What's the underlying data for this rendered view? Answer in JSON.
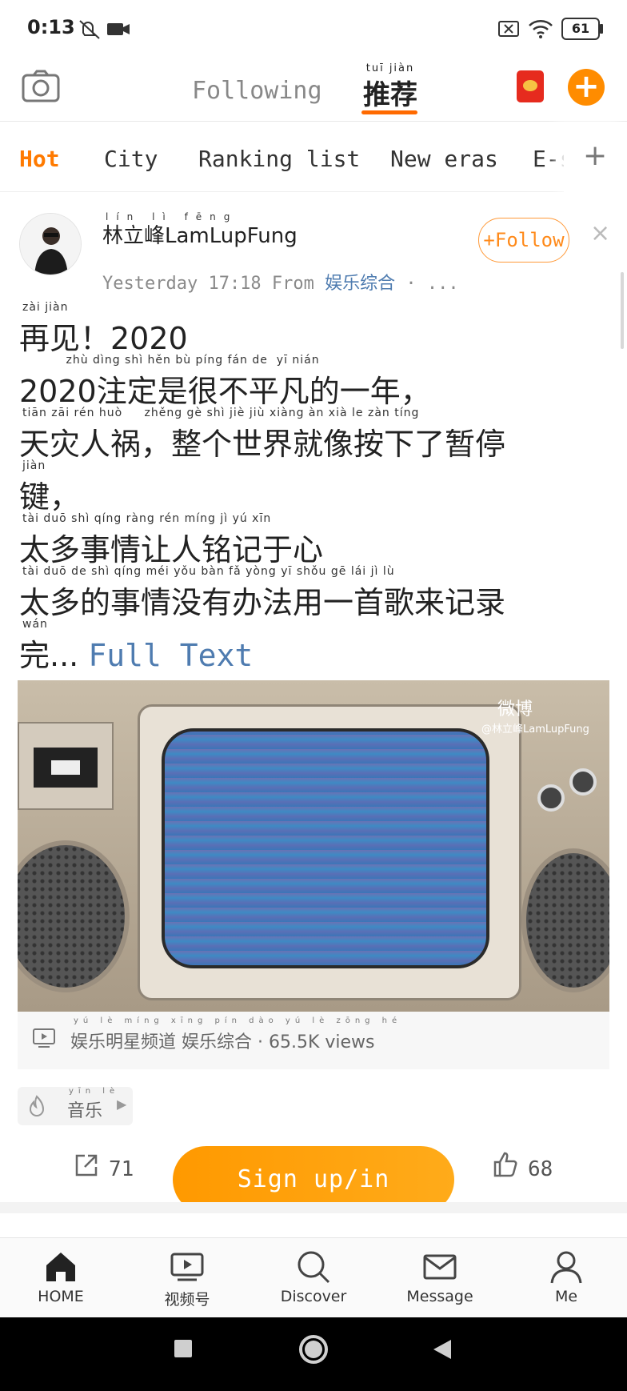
{
  "status_bar": {
    "time": "0:13",
    "battery": "61",
    "icons": [
      "mute-icon",
      "video-record-icon",
      "sim-x-icon",
      "wifi-icon",
      "battery-icon"
    ]
  },
  "header": {
    "tab_following": "Following",
    "tab_recommend": "推荐",
    "tab_recommend_pinyin": "tuī jiàn",
    "add_label": "+",
    "accent_color": "#ff7a00"
  },
  "categories": {
    "items": [
      "Hot",
      "City",
      "Ranking list",
      "New eras",
      "E-s"
    ],
    "more": "+"
  },
  "post": {
    "username": "林立峰LamLupFung",
    "username_pinyin": "lín lì fēng",
    "time": "Yesterday  17:18 From ",
    "source": "娱乐综合",
    "source_pinyin": "yú lè zōng hé",
    "meta_suffix": " · ...",
    "follow_label": "+Follow",
    "close_label": "×",
    "lines": [
      {
        "text": "再见！2020",
        "pinyin": "zài jiàn"
      },
      {
        "text": "2020注定是很不平凡的一年，",
        "pinyin": "          zhù dìng shì hěn bù píng fán de  yī nián"
      },
      {
        "text": "天灾人祸，整个世界就像按下了暂停",
        "pinyin": "tiān zāi rén huò     zhěng gè shì jiè jiù xiàng àn xià le zàn tíng"
      },
      {
        "text": "键，",
        "pinyin": "jiàn"
      },
      {
        "text": "太多事情让人铭记于心",
        "pinyin": "tài duō shì qíng ràng rén míng jì  yú xīn"
      },
      {
        "text": "太多的事情没有办法用一首歌来记录",
        "pinyin": "tài duō de shì qíng méi yǒu bàn fǎ yòng yī shǒu gē lái jì lù"
      },
      {
        "text": "完...",
        "pinyin": "wán"
      }
    ],
    "full_text_label": "Full Text",
    "video_watermark": "微博",
    "video_watermark_sub": "@林立峰LamLupFung",
    "video_info": "娱乐明星频道  娱乐综合  ·  65.5K views",
    "video_info_pinyin": "yú lè míng xīng pín dào  yú lè zōng hé",
    "topic": "音乐",
    "topic_pinyin": "yīn lè",
    "share_count": "71",
    "signup_label": "Sign up/in",
    "like_count": "68"
  },
  "bottom_nav": {
    "items": [
      {
        "label": "HOME",
        "icon": "home-icon"
      },
      {
        "label": "视频号",
        "icon": "video-channel-icon"
      },
      {
        "label": "Discover",
        "icon": "search-icon"
      },
      {
        "label": "Message",
        "icon": "mail-icon"
      },
      {
        "label": "Me",
        "icon": "person-icon"
      }
    ]
  }
}
